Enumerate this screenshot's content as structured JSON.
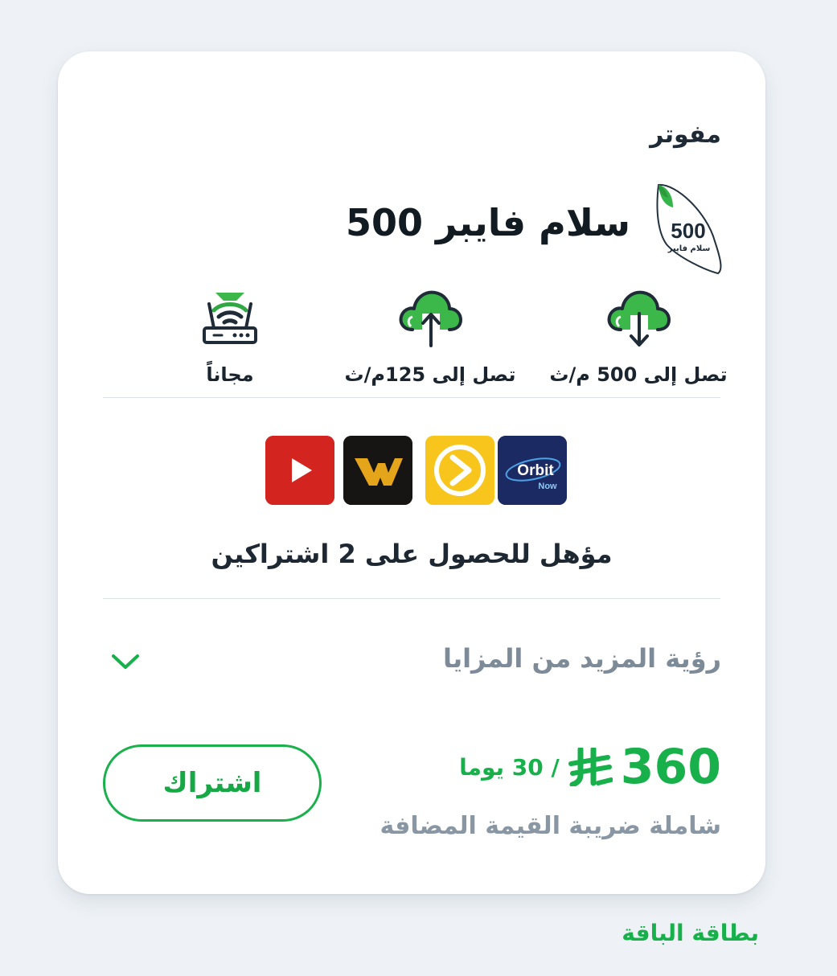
{
  "card": {
    "plan_type": "مفوتر",
    "plan_name": "سلام فايبر 500",
    "badge": {
      "number": "500",
      "caption": "سلام فايبر"
    },
    "features": [
      {
        "icon": "cloud-download-icon",
        "label": "تصل إلى 500 م/ث"
      },
      {
        "icon": "cloud-upload-icon",
        "label": "تصل إلى 125م/ث"
      },
      {
        "icon": "wifi-router-icon",
        "label": "مجاناً"
      }
    ],
    "apps": [
      {
        "name": "youtube-app-icon",
        "color": "#d42420"
      },
      {
        "name": "weyyak-app-icon",
        "color": "#171513",
        "glyph": "W"
      },
      {
        "name": "shahid-app-icon",
        "color": "#f7c51b"
      },
      {
        "name": "orbit-now-app-icon",
        "color": "#1c2a63",
        "text": "Orbit",
        "subtext": "Now"
      }
    ],
    "eligible_text": "مؤهل للحصول على 2 اشتراكين",
    "more_benefits": "رؤية المزيد من المزايا",
    "price": {
      "amount": "360",
      "period": "/ 30 يوما",
      "vat_note": "شاملة ضريبة القيمة المضافة"
    },
    "subscribe_label": "اشتراك"
  },
  "footer": {
    "link": "بطاقة الباقة"
  },
  "colors": {
    "accent": "#17b04a",
    "text_dark": "#1e2833",
    "text_muted": "#7d8a97",
    "background": "#eef2f6"
  }
}
